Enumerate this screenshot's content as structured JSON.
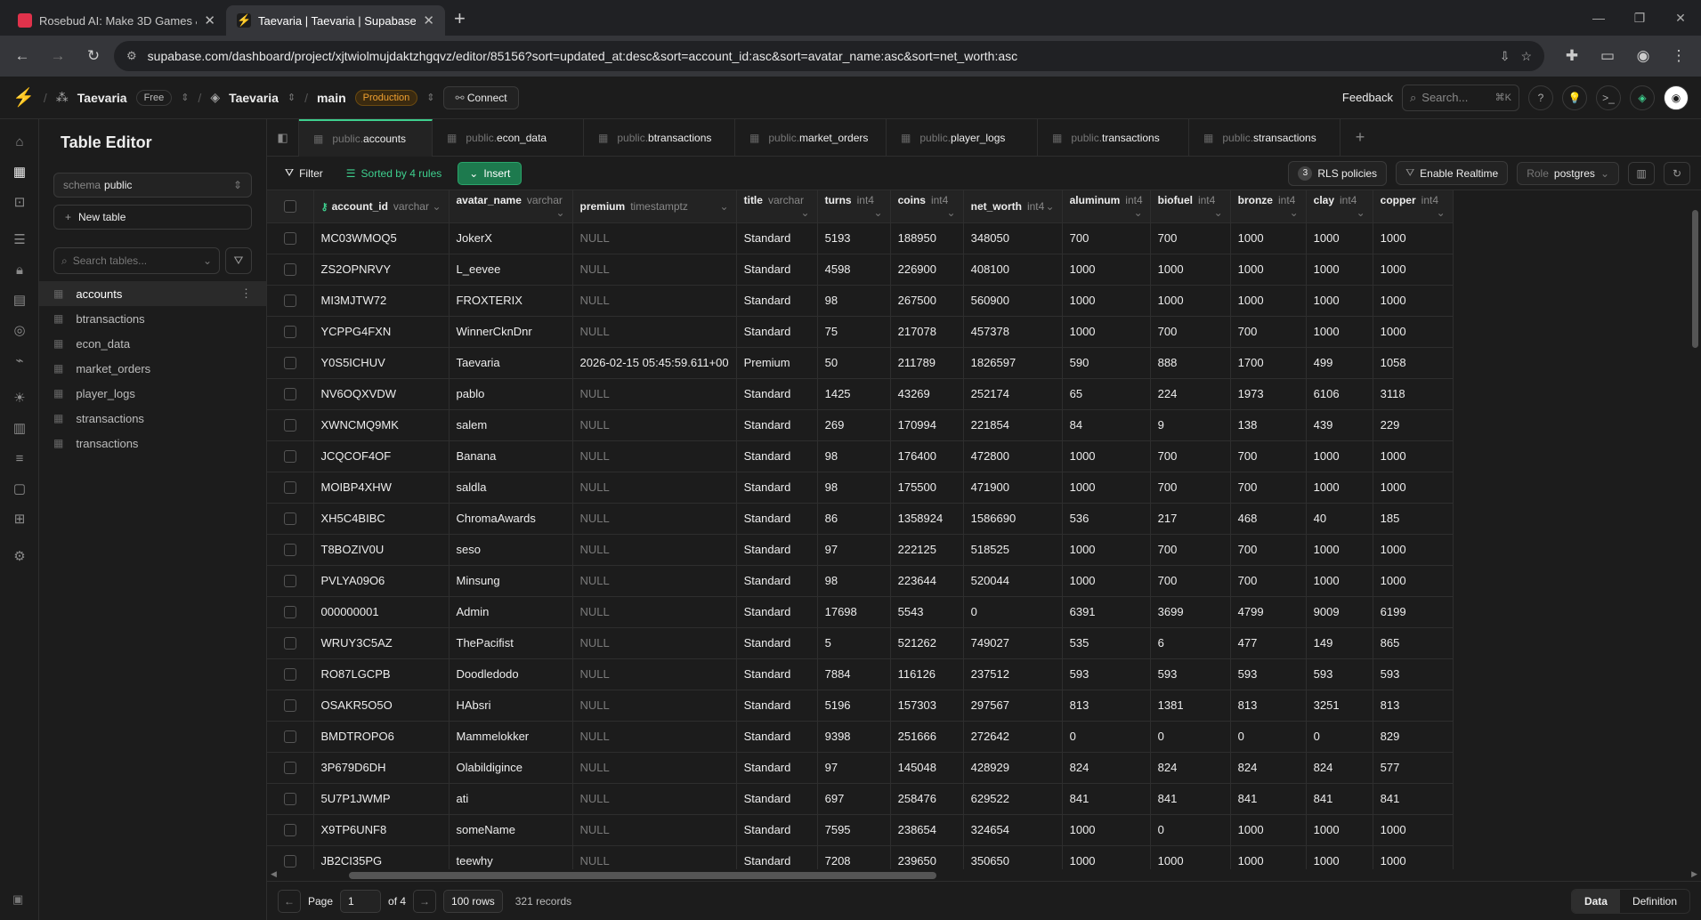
{
  "browser": {
    "tabs": [
      {
        "title": "Rosebud AI: Make 3D Games &",
        "active": false,
        "color": "#e0324b"
      },
      {
        "title": "Taevaria | Taevaria | Supabase",
        "active": true,
        "color": "#3ecf8e"
      }
    ],
    "url": "supabase.com/dashboard/project/xjtwiolmujdaktzhgqvz/editor/85156?sort=updated_at:desc&sort=account_id:asc&sort=avatar_name:asc&sort=net_worth:asc"
  },
  "appbar": {
    "org": "Taevaria",
    "plan": "Free",
    "project": "Taevaria",
    "branch": "main",
    "env": "Production",
    "connect": "Connect",
    "feedback": "Feedback",
    "search_placeholder": "Search...",
    "search_shortcut": "⌘K"
  },
  "sidebar": {
    "title": "Table Editor",
    "schema_label": "schema",
    "schema_value": "public",
    "new_table": "New table",
    "search_placeholder": "Search tables...",
    "tables": [
      "accounts",
      "btransactions",
      "econ_data",
      "market_orders",
      "player_logs",
      "stransactions",
      "transactions"
    ]
  },
  "tabs": [
    {
      "schema": "public.",
      "name": "accounts"
    },
    {
      "schema": "public.",
      "name": "econ_data"
    },
    {
      "schema": "public.",
      "name": "btransactions"
    },
    {
      "schema": "public.",
      "name": "market_orders"
    },
    {
      "schema": "public.",
      "name": "player_logs"
    },
    {
      "schema": "public.",
      "name": "transactions"
    },
    {
      "schema": "public.",
      "name": "stransactions"
    }
  ],
  "toolbar": {
    "filter": "Filter",
    "sorted": "Sorted by 4 rules",
    "insert": "Insert",
    "rls_count": "3",
    "rls": "RLS policies",
    "realtime": "Enable Realtime",
    "role_label": "Role",
    "role": "postgres"
  },
  "columns": [
    {
      "name": "account_id",
      "type": "varchar"
    },
    {
      "name": "avatar_name",
      "type": "varchar"
    },
    {
      "name": "premium",
      "type": "timestamptz"
    },
    {
      "name": "title",
      "type": "varchar"
    },
    {
      "name": "turns",
      "type": "int4"
    },
    {
      "name": "coins",
      "type": "int4"
    },
    {
      "name": "net_worth",
      "type": "int4"
    },
    {
      "name": "aluminum",
      "type": "int4"
    },
    {
      "name": "biofuel",
      "type": "int4"
    },
    {
      "name": "bronze",
      "type": "int4"
    },
    {
      "name": "clay",
      "type": "int4"
    },
    {
      "name": "copper",
      "type": "int4"
    }
  ],
  "rows": [
    [
      "MC03WMOQ5",
      "JokerX",
      "NULL",
      "Standard",
      "5193",
      "188950",
      "348050",
      "700",
      "700",
      "1000",
      "1000",
      "1000"
    ],
    [
      "ZS2OPNRVY",
      "L_eevee",
      "NULL",
      "Standard",
      "4598",
      "226900",
      "408100",
      "1000",
      "1000",
      "1000",
      "1000",
      "1000"
    ],
    [
      "MI3MJTW72",
      "FROXTERIX",
      "NULL",
      "Standard",
      "98",
      "267500",
      "560900",
      "1000",
      "1000",
      "1000",
      "1000",
      "1000"
    ],
    [
      "YCPPG4FXN",
      "WinnerCknDnr",
      "NULL",
      "Standard",
      "75",
      "217078",
      "457378",
      "1000",
      "700",
      "700",
      "1000",
      "1000"
    ],
    [
      "Y0S5ICHUV",
      "Taevaria",
      "2026-02-15 05:45:59.611+00",
      "Premium",
      "50",
      "211789",
      "1826597",
      "590",
      "888",
      "1700",
      "499",
      "1058"
    ],
    [
      "NV6OQXVDW",
      "pablo",
      "NULL",
      "Standard",
      "1425",
      "43269",
      "252174",
      "65",
      "224",
      "1973",
      "6106",
      "3118"
    ],
    [
      "XWNCMQ9MK",
      "salem",
      "NULL",
      "Standard",
      "269",
      "170994",
      "221854",
      "84",
      "9",
      "138",
      "439",
      "229"
    ],
    [
      "JCQCOF4OF",
      "Banana",
      "NULL",
      "Standard",
      "98",
      "176400",
      "472800",
      "1000",
      "700",
      "700",
      "1000",
      "1000"
    ],
    [
      "MOIBP4XHW",
      "saldla",
      "NULL",
      "Standard",
      "98",
      "175500",
      "471900",
      "1000",
      "700",
      "700",
      "1000",
      "1000"
    ],
    [
      "XH5C4BIBC",
      "ChromaAwards",
      "NULL",
      "Standard",
      "86",
      "1358924",
      "1586690",
      "536",
      "217",
      "468",
      "40",
      "185"
    ],
    [
      "T8BOZIV0U",
      "seso",
      "NULL",
      "Standard",
      "97",
      "222125",
      "518525",
      "1000",
      "700",
      "700",
      "1000",
      "1000"
    ],
    [
      "PVLYA09O6",
      "Minsung",
      "NULL",
      "Standard",
      "98",
      "223644",
      "520044",
      "1000",
      "700",
      "700",
      "1000",
      "1000"
    ],
    [
      "000000001",
      "Admin",
      "NULL",
      "Standard",
      "17698",
      "5543",
      "0",
      "6391",
      "3699",
      "4799",
      "9009",
      "6199"
    ],
    [
      "WRUY3C5AZ",
      "ThePacifist",
      "NULL",
      "Standard",
      "5",
      "521262",
      "749027",
      "535",
      "6",
      "477",
      "149",
      "865"
    ],
    [
      "RO87LGCPB",
      "Doodledodo",
      "NULL",
      "Standard",
      "7884",
      "116126",
      "237512",
      "593",
      "593",
      "593",
      "593",
      "593"
    ],
    [
      "OSAKR5O5O",
      "HAbsri",
      "NULL",
      "Standard",
      "5196",
      "157303",
      "297567",
      "813",
      "1381",
      "813",
      "3251",
      "813"
    ],
    [
      "BMDTROPO6",
      "Mammelokker",
      "NULL",
      "Standard",
      "9398",
      "251666",
      "272642",
      "0",
      "0",
      "0",
      "0",
      "829"
    ],
    [
      "3P679D6DH",
      "Olabildigince",
      "NULL",
      "Standard",
      "97",
      "145048",
      "428929",
      "824",
      "824",
      "824",
      "824",
      "577"
    ],
    [
      "5U7P1JWMP",
      "ati",
      "NULL",
      "Standard",
      "697",
      "258476",
      "629522",
      "841",
      "841",
      "841",
      "841",
      "841"
    ],
    [
      "X9TP6UNF8",
      "someName",
      "NULL",
      "Standard",
      "7595",
      "238654",
      "324654",
      "1000",
      "0",
      "1000",
      "1000",
      "1000"
    ],
    [
      "JB2CI35PG",
      "teewhy",
      "NULL",
      "Standard",
      "7208",
      "239650",
      "350650",
      "1000",
      "1000",
      "1000",
      "1000",
      "1000"
    ]
  ],
  "footer": {
    "page_label": "Page",
    "page": "1",
    "of": "of 4",
    "rows": "100 rows",
    "records": "321 records",
    "data": "Data",
    "definition": "Definition"
  }
}
